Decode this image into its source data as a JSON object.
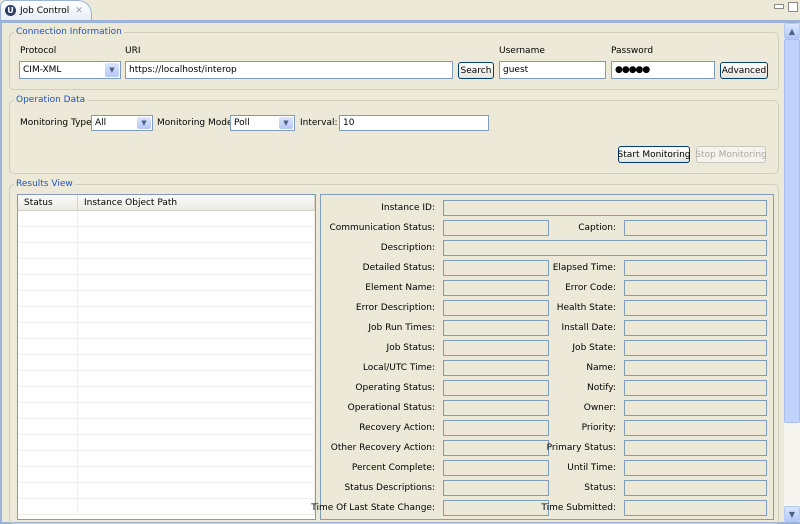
{
  "tab": {
    "title": "Job Control",
    "icon": "job-control-icon",
    "close_icon": "close-icon"
  },
  "window_controls": {
    "minimize": "minimize-icon",
    "maximize": "maximize-icon"
  },
  "connection": {
    "title": "Connection Information",
    "protocol_label": "Protocol",
    "protocol_value": "CIM-XML",
    "uri_label": "URI",
    "uri_value": "https://localhost/interop",
    "search_button": "Search",
    "username_label": "Username",
    "username_value": "guest",
    "password_label": "Password",
    "password_value": "●●●●●",
    "advanced_button": "Advanced"
  },
  "operation": {
    "title": "Operation Data",
    "monitoring_type_label": "Monitoring Type:",
    "monitoring_type_value": "All",
    "monitoring_mode_label": "Monitoring Mode:",
    "monitoring_mode_value": "Poll",
    "interval_label": "Interval:",
    "interval_value": "10",
    "start_button": "Start Monitoring",
    "stop_button": "Stop Monitoring"
  },
  "results": {
    "title": "Results View",
    "columns": [
      "Status",
      "Instance Object Path"
    ],
    "fields": [
      {
        "left": "Instance ID:",
        "right": null
      },
      {
        "left": "Communication Status:",
        "right": "Caption:"
      },
      {
        "left": "Description:",
        "right": null
      },
      {
        "left": "Detailed Status:",
        "right": "Elapsed Time:"
      },
      {
        "left": "Element Name:",
        "right": "Error Code:"
      },
      {
        "left": "Error Description:",
        "right": "Health State:"
      },
      {
        "left": "Job Run Times:",
        "right": "Install Date:"
      },
      {
        "left": "Job Status:",
        "right": "Job State:"
      },
      {
        "left": "Local/UTC Time:",
        "right": "Name:"
      },
      {
        "left": "Operating Status:",
        "right": "Notify:"
      },
      {
        "left": "Operational Status:",
        "right": "Owner:"
      },
      {
        "left": "Recovery Action:",
        "right": "Priority:"
      },
      {
        "left": "Other Recovery Action:",
        "right": "Primary Status:"
      },
      {
        "left": "Percent Complete:",
        "right": "Until Time:"
      },
      {
        "left": "Status Descriptions:",
        "right": "Status:"
      },
      {
        "left": "Time Of Last State Change:",
        "right": "Time Submitted:"
      }
    ]
  }
}
